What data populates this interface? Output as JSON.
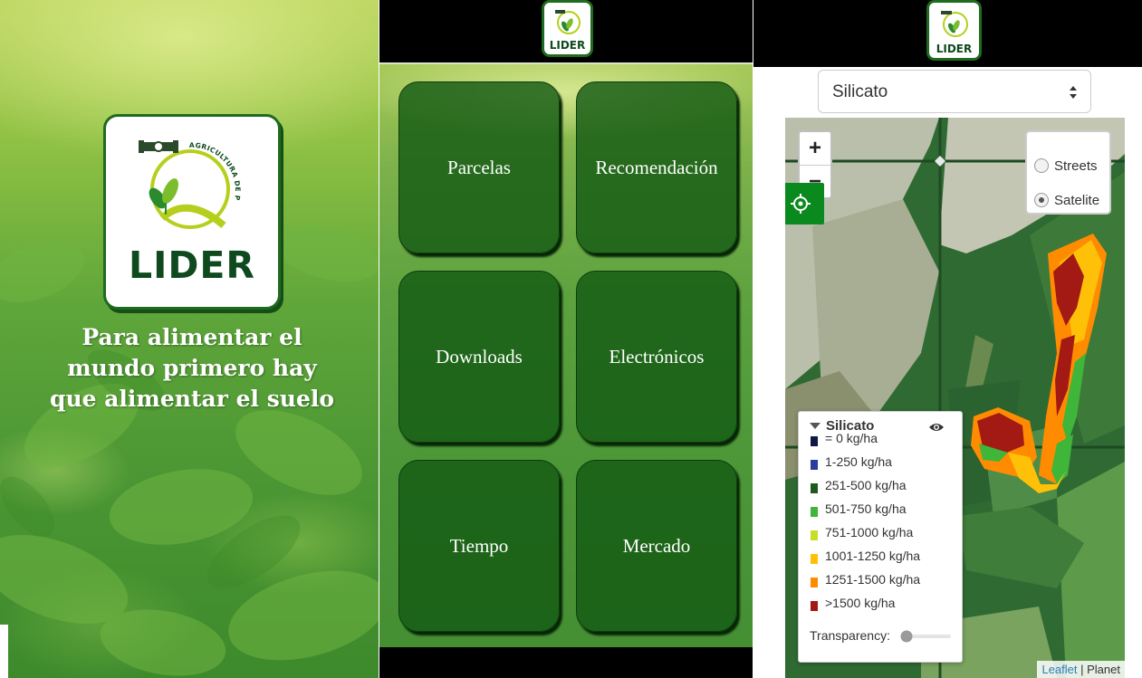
{
  "splash": {
    "logo": {
      "arc_text": "AGRICULTURA DE PRECISIÓN",
      "word": "LIDER"
    },
    "slogan": [
      "Para alimentar el",
      "mundo primero hay",
      "que alimentar el suelo"
    ]
  },
  "menu": {
    "logo_word": "LIDER",
    "tiles": [
      "Parcelas",
      "Recomendación",
      "Downloads",
      "Electrónicos",
      "Tiempo",
      "Mercado"
    ]
  },
  "map_screen": {
    "logo_word": "LIDER",
    "layer_select": {
      "selected": "Silicato"
    },
    "zoom": {
      "in": "+",
      "out": "−"
    },
    "base_layers": [
      {
        "label": "Streets",
        "selected": false
      },
      {
        "label": "Satelite",
        "selected": true
      }
    ],
    "legend": {
      "title": "Silicato",
      "items": [
        {
          "label": "= 0 kg/ha",
          "color": "#101742"
        },
        {
          "label": "1-250 kg/ha",
          "color": "#2b3c9a"
        },
        {
          "label": "251-500 kg/ha",
          "color": "#1d5a1f"
        },
        {
          "label": "501-750 kg/ha",
          "color": "#3fb53a"
        },
        {
          "label": "751-1000 kg/ha",
          "color": "#c8dd2a"
        },
        {
          "label": "1001-1250 kg/ha",
          "color": "#ffc107"
        },
        {
          "label": "1251-1500 kg/ha",
          "color": "#ff8c00"
        },
        {
          "label": ">1500 kg/ha",
          "color": "#a31a14"
        }
      ],
      "transparency_label": "Transparency:",
      "transparency_value": 0
    },
    "attribution": {
      "leaflet": "Leaflet",
      "separator": " | ",
      "planet": "Planet"
    }
  },
  "colors": {
    "brand_green": "#0e4a1d",
    "tile_green": "#145a14",
    "locate_green": "#0a8a1e"
  }
}
